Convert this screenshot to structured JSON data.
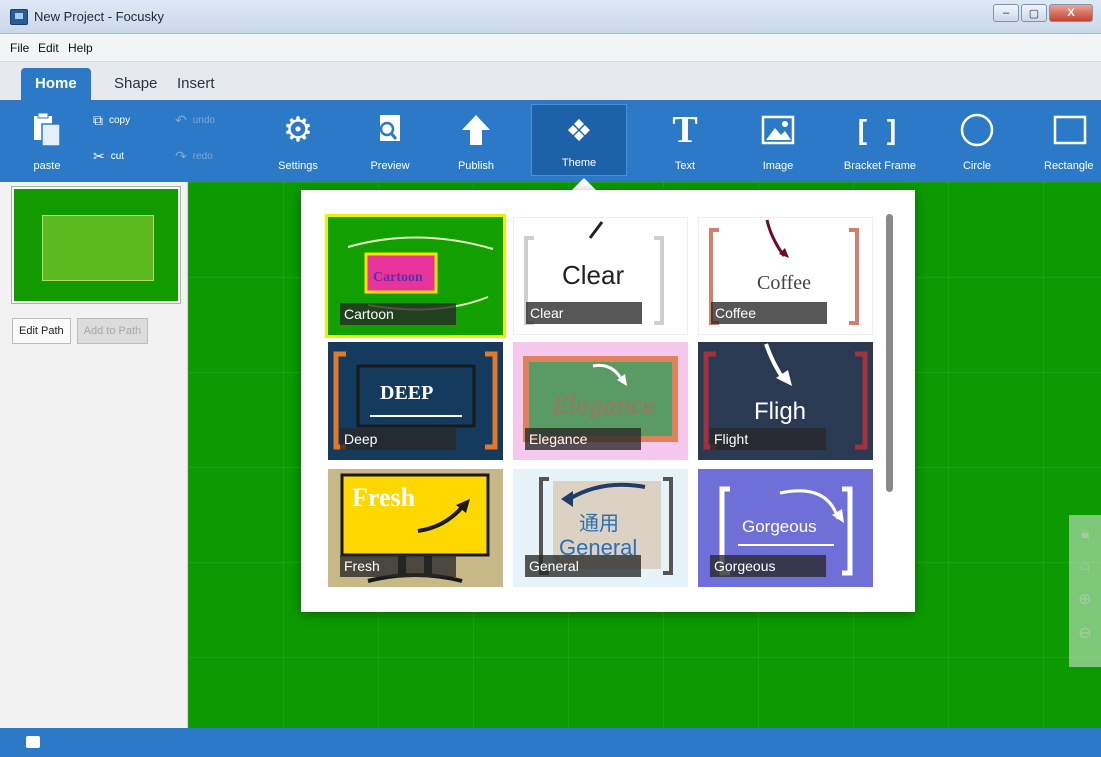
{
  "window": {
    "title": "New Project - Focusky",
    "min": "–",
    "max": "▢",
    "close": "X"
  },
  "menu": [
    {
      "label": "File"
    },
    {
      "label": "Edit"
    },
    {
      "label": "Help"
    }
  ],
  "tabs": [
    {
      "label": "Home"
    },
    {
      "label": "Shape"
    },
    {
      "label": "Insert"
    }
  ],
  "ribbon": {
    "paste": "paste",
    "copy": "copy",
    "cut": "cut",
    "undo": "undo",
    "redo": "redo",
    "settings": "Settings",
    "preview": "Preview",
    "publish": "Publish",
    "theme": "Theme",
    "text": "Text",
    "image": "Image",
    "bracket_frame": "Bracket Frame",
    "circle": "Circle",
    "rectangle": "Rectangle"
  },
  "left_panel": {
    "edit_path": "Edit Path",
    "add_to_path": "Add to Path"
  },
  "themes": [
    {
      "name": "Cartoon",
      "preview_text": "Cartoon",
      "selected": true
    },
    {
      "name": "Clear",
      "preview_text": "Clear"
    },
    {
      "name": "Coffee",
      "preview_text": "Coffee"
    },
    {
      "name": "Deep",
      "preview_text": "DEEP"
    },
    {
      "name": "Elegance",
      "preview_text": "Elegance"
    },
    {
      "name": "Flight",
      "preview_text": "Fligh"
    },
    {
      "name": "Fresh",
      "preview_text": "Fresh"
    },
    {
      "name": "General",
      "preview_text": "通用",
      "preview_text2": "General"
    },
    {
      "name": "Gorgeous",
      "preview_text": "Gorgeous"
    }
  ],
  "colors": {
    "accent": "#2c7ac7",
    "canvas": "#0c9a02",
    "selected_outline": "#e9f200"
  }
}
